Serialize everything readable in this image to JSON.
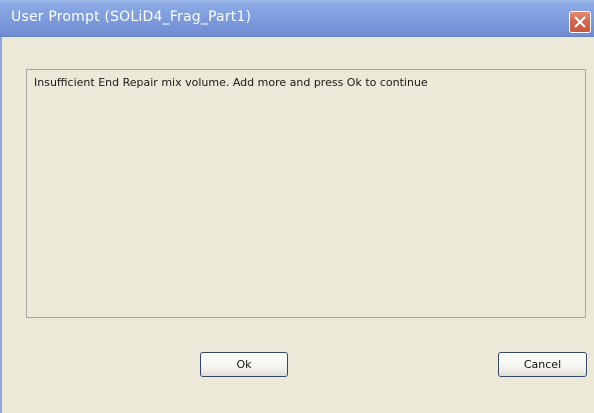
{
  "window": {
    "title": "User Prompt (SOLiD4_Frag_Part1)"
  },
  "message": {
    "text": "Insufficient End Repair mix volume. Add more and press Ok to continue"
  },
  "buttons": {
    "ok_label": "Ok",
    "cancel_label": "Cancel"
  },
  "icons": {
    "close": "close-icon"
  },
  "colors": {
    "titlebar": "#7f9ede",
    "close_button": "#d2664c",
    "window_background": "#ece9d8"
  }
}
